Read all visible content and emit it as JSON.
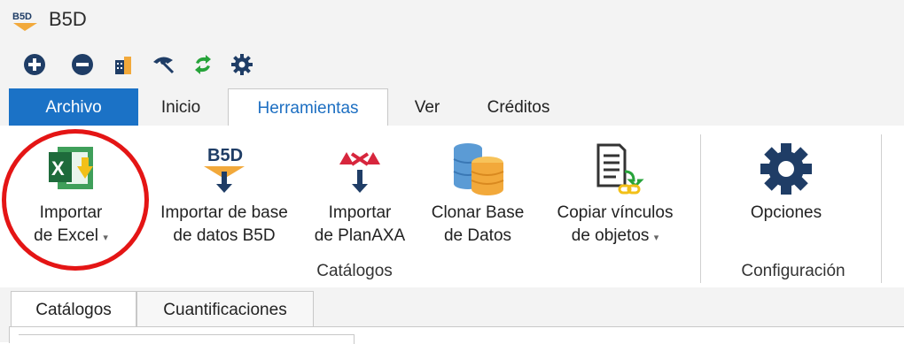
{
  "app": {
    "title": "B5D",
    "logo_text": "B5D"
  },
  "quick_access": [
    {
      "name": "add-icon"
    },
    {
      "name": "remove-icon"
    },
    {
      "name": "building-icon"
    },
    {
      "name": "view-icon"
    },
    {
      "name": "refresh-icon"
    },
    {
      "name": "settings-icon"
    },
    {
      "name": "customize-icon"
    }
  ],
  "tabs": [
    {
      "label": "Archivo"
    },
    {
      "label": "Inicio"
    },
    {
      "label": "Herramientas",
      "active": true
    },
    {
      "label": "Ver"
    },
    {
      "label": "Créditos"
    }
  ],
  "ribbon": {
    "buttons": [
      {
        "line1": "Importar",
        "line2": "de Excel",
        "has_dropdown": true,
        "icon": "excel-icon"
      },
      {
        "line1": "Importar de base",
        "line2": "de datos B5D",
        "icon": "b5d-import-icon"
      },
      {
        "line1": "Importar",
        "line2": "de PlanAXA",
        "icon": "axa-import-icon"
      },
      {
        "line1": "Clonar Base",
        "line2": "de Datos",
        "icon": "database-clone-icon"
      },
      {
        "line1": "Copiar vínculos",
        "line2": "de objetos",
        "has_dropdown": true,
        "icon": "copy-links-icon"
      },
      {
        "line1": "Opciones",
        "line2": "",
        "icon": "gear-icon"
      }
    ],
    "groups": [
      {
        "label": "Catálogos"
      },
      {
        "label": "Configuración"
      }
    ]
  },
  "document_tabs": [
    {
      "label": "Catálogos",
      "active": true
    },
    {
      "label": "Cuantificaciones"
    }
  ],
  "colors": {
    "accent": "#1b72c6",
    "highlight_circle": "#e41515",
    "icon_navy": "#1f3d66"
  }
}
